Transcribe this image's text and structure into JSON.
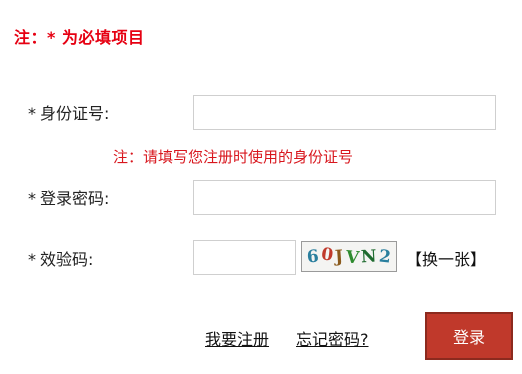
{
  "note": "注：* 为必填项目",
  "form": {
    "id_number": {
      "star": "*",
      "label": "身份证号:",
      "value": "",
      "hint": "注：请填写您注册时使用的身份证号"
    },
    "password": {
      "star": "*",
      "label": "登录密码:",
      "value": ""
    },
    "captcha": {
      "star": "*",
      "label": "效验码:",
      "value": "",
      "image_chars": [
        "6",
        "0",
        "J",
        "V",
        "N",
        "2"
      ],
      "image_colors": [
        "#2a7f9e",
        "#c0392b",
        "#8a5a1c",
        "#2e8b2e",
        "#1f6b2f",
        "#2a7f9e"
      ],
      "refresh_label": "【换一张】"
    }
  },
  "links": {
    "register": "我要注册",
    "forgot_password": "忘记密码?"
  },
  "login_button": "登录",
  "colors": {
    "note": "#e60012",
    "hint": "#d8161d",
    "button_bg": "#c0392b",
    "button_border": "#8c2a1e"
  }
}
